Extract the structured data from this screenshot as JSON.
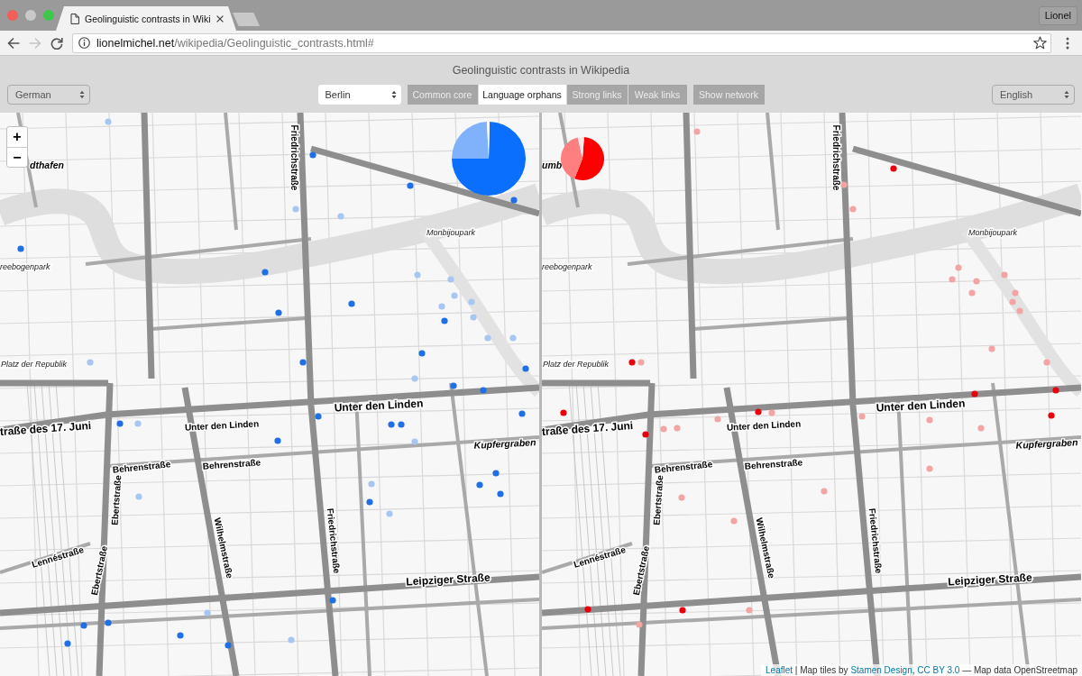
{
  "browser": {
    "tab_title": "Geolinguistic contrasts in Wiki",
    "url_host": "lionelmichel.net",
    "url_path": "/wikipedia/Geolinguistic_contrasts.html#",
    "profile": "Lionel"
  },
  "header": {
    "title": "Geolinguistic contrasts in Wikipedia",
    "left_language": "German",
    "city": "Berlin",
    "modes": [
      {
        "label": "Common core",
        "selected": false
      },
      {
        "label": "Language orphans",
        "selected": true
      },
      {
        "label": "Strong links",
        "selected": false
      },
      {
        "label": "Weak links",
        "selected": false
      }
    ],
    "network_button": "Show network",
    "right_language": "English"
  },
  "maps": [
    {
      "zoom_controls": [
        "+",
        "−"
      ],
      "labels": [
        {
          "text": "dthafen",
          "kind": "water"
        },
        {
          "text": "Friedrichstraße",
          "kind": "street"
        },
        {
          "text": "Monbijoupark",
          "kind": "place"
        },
        {
          "text": "reebogenpark",
          "kind": "place"
        },
        {
          "text": "Platz der Republik",
          "kind": "place"
        },
        {
          "text": "traße des 17. Juni",
          "kind": "major"
        },
        {
          "text": "Unter den Linden",
          "kind": "street"
        },
        {
          "text": "Unter den Linden",
          "kind": "major"
        },
        {
          "text": "Kupfergraben",
          "kind": "water"
        },
        {
          "text": "Behrenstraße",
          "kind": "street"
        },
        {
          "text": "Behrenstraße",
          "kind": "street"
        },
        {
          "text": "Ebertstraße",
          "kind": "street"
        },
        {
          "text": "Wilhelmstraße",
          "kind": "street"
        },
        {
          "text": "Friedrichstraße",
          "kind": "street"
        },
        {
          "text": "Lennéstraße",
          "kind": "street"
        },
        {
          "text": "Ebertstraße",
          "kind": "street"
        },
        {
          "text": "Leipziger Straße",
          "kind": "major"
        }
      ],
      "markers": [
        {
          "color": "#a7c6f2"
        },
        {
          "color": "#1f6fe5"
        },
        {
          "color": "#1f6fe5"
        },
        {
          "color": "#1f6fe5"
        },
        {
          "color": "#a7c6f2"
        },
        {
          "color": "#a7c6f2"
        },
        {
          "color": "#1f6fe5"
        },
        {
          "color": "#1f6fe5"
        },
        {
          "color": "#1f6fe5"
        },
        {
          "color": "#1f6fe5"
        },
        {
          "color": "#a7c6f2"
        },
        {
          "color": "#a7c6f2"
        },
        {
          "color": "#a7c6f2"
        },
        {
          "color": "#a7c6f2"
        },
        {
          "color": "#a7c6f2"
        },
        {
          "color": "#1f6fe5"
        },
        {
          "color": "#a7c6f2"
        },
        {
          "color": "#a7c6f2"
        },
        {
          "color": "#a7c6f2"
        },
        {
          "color": "#a7c6f2"
        },
        {
          "color": "#1f6fe5"
        },
        {
          "color": "#1f6fe5"
        },
        {
          "color": "#1f6fe5"
        },
        {
          "color": "#a7c6f2"
        },
        {
          "color": "#1f6fe5"
        },
        {
          "color": "#1f6fe5"
        },
        {
          "color": "#1f6fe5"
        },
        {
          "color": "#a7c6f2"
        },
        {
          "color": "#1f6fe5"
        },
        {
          "color": "#1f6fe5"
        },
        {
          "color": "#1f6fe5"
        },
        {
          "color": "#1f6fe5"
        },
        {
          "color": "#a7c6f2"
        },
        {
          "color": "#1f6fe5"
        },
        {
          "color": "#1f6fe5"
        },
        {
          "color": "#1f6fe5"
        },
        {
          "color": "#1f6fe5"
        },
        {
          "color": "#a7c6f2"
        },
        {
          "color": "#1f6fe5"
        },
        {
          "color": "#a7c6f2"
        },
        {
          "color": "#a7c6f2"
        },
        {
          "color": "#1f6fe5"
        },
        {
          "color": "#1f6fe5"
        },
        {
          "color": "#1f6fe5"
        },
        {
          "color": "#a7c6f2"
        },
        {
          "color": "#1f6fe5"
        },
        {
          "color": "#1f6fe5"
        },
        {
          "color": "#1f6fe5"
        },
        {
          "color": "#a7c6f2"
        }
      ]
    },
    {
      "labels": [
        {
          "text": "umb",
          "kind": "water"
        },
        {
          "text": "Friedrichstraße",
          "kind": "street"
        },
        {
          "text": "Monbijoupark",
          "kind": "place"
        },
        {
          "text": "reebogenpark",
          "kind": "place"
        },
        {
          "text": "Platz der Republik",
          "kind": "place"
        },
        {
          "text": "traße des 17. Juni",
          "kind": "major"
        },
        {
          "text": "Unter den Linden",
          "kind": "street"
        },
        {
          "text": "Unter den Linden",
          "kind": "major"
        },
        {
          "text": "Kupfergraben",
          "kind": "water"
        },
        {
          "text": "Behrenstraße",
          "kind": "street"
        },
        {
          "text": "Behrenstraße",
          "kind": "street"
        },
        {
          "text": "Ebertstraße",
          "kind": "street"
        },
        {
          "text": "Wilhelmstraße",
          "kind": "street"
        },
        {
          "text": "Friedrichstraße",
          "kind": "street"
        },
        {
          "text": "Lennéstraße",
          "kind": "street"
        },
        {
          "text": "Ebertstraße",
          "kind": "street"
        },
        {
          "text": "Leipziger Straße",
          "kind": "major"
        }
      ],
      "markers": [
        {
          "color": "#f3a5a5"
        },
        {
          "color": "#e8000b"
        },
        {
          "color": "#f3a5a5"
        },
        {
          "color": "#f3a5a5"
        },
        {
          "color": "#f3a5a5"
        },
        {
          "color": "#f3a5a5"
        },
        {
          "color": "#f3a5a5"
        },
        {
          "color": "#f3a5a5"
        },
        {
          "color": "#f3a5a5"
        },
        {
          "color": "#f3a5a5"
        },
        {
          "color": "#f3a5a5"
        },
        {
          "color": "#f3a5a5"
        },
        {
          "color": "#e8000b"
        },
        {
          "color": "#f3a5a5"
        },
        {
          "color": "#f3a5a5"
        },
        {
          "color": "#f3a5a5"
        },
        {
          "color": "#e8000b"
        },
        {
          "color": "#e8000b"
        },
        {
          "color": "#e8000b"
        },
        {
          "color": "#e8000b"
        },
        {
          "color": "#e8000b"
        },
        {
          "color": "#f3a5a5"
        },
        {
          "color": "#f3a5a5"
        },
        {
          "color": "#f3a5a5"
        },
        {
          "color": "#e8000b"
        },
        {
          "color": "#f3a5a5"
        },
        {
          "color": "#f3a5a5"
        },
        {
          "color": "#f3a5a5"
        },
        {
          "color": "#f3a5a5"
        },
        {
          "color": "#f3a5a5"
        },
        {
          "color": "#f3a5a5"
        },
        {
          "color": "#f3a5a5"
        },
        {
          "color": "#f3a5a5"
        },
        {
          "color": "#e8000b"
        },
        {
          "color": "#e8000b"
        },
        {
          "color": "#f3a5a5"
        },
        {
          "color": "#f3a5a5"
        }
      ]
    }
  ],
  "attribution": [
    {
      "text": "Leaflet",
      "kind": "link"
    },
    {
      "text": " | Map tiles by ",
      "kind": "text"
    },
    {
      "text": "Stamen Design",
      "kind": "link"
    },
    {
      "text": ", ",
      "kind": "text"
    },
    {
      "text": "CC BY 3.0",
      "kind": "link"
    },
    {
      "text": " — Map data OpenStreetmap",
      "kind": "text"
    }
  ]
}
